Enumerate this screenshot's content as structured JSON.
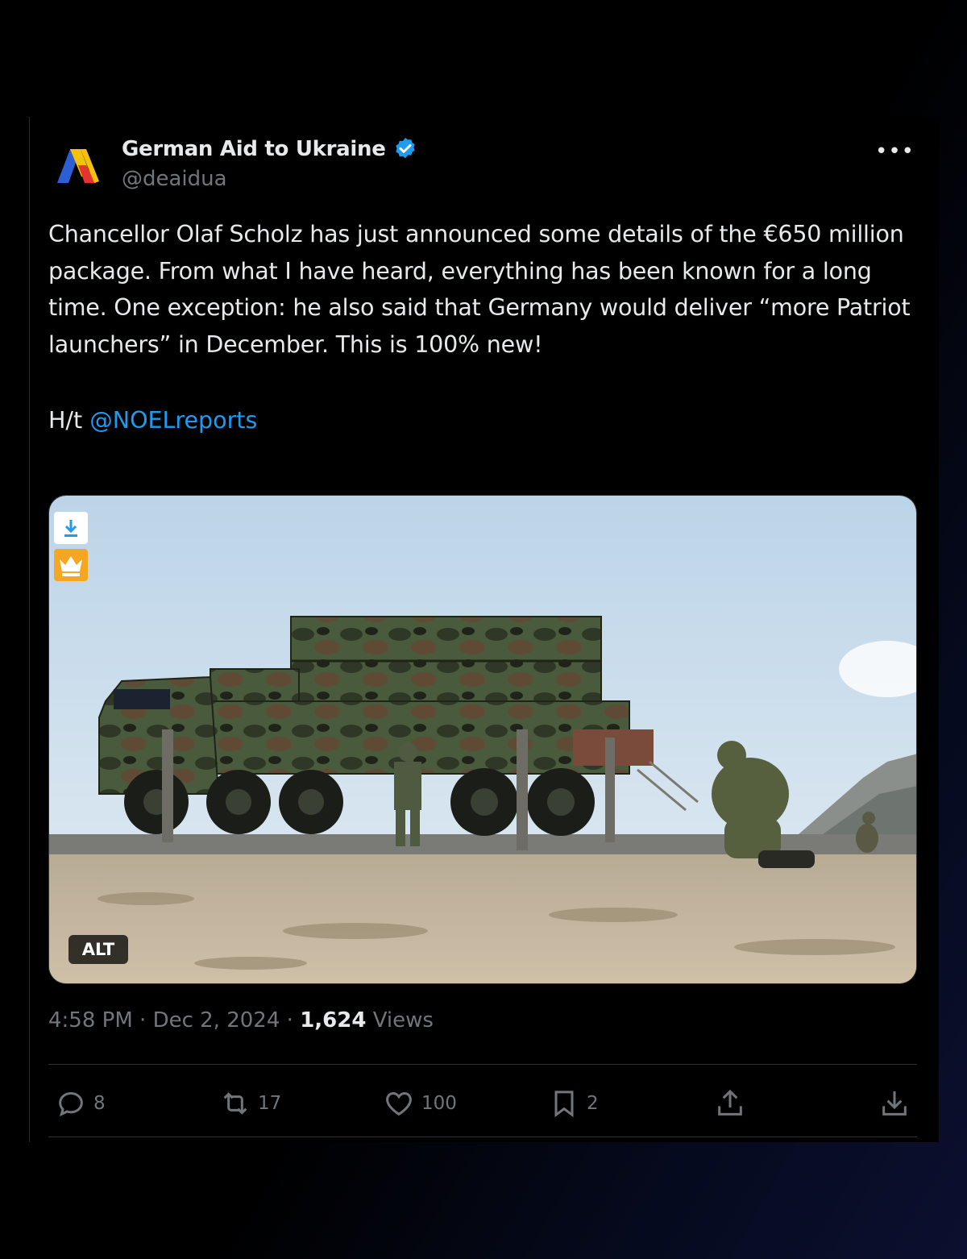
{
  "author": {
    "display_name": "German Aid to Ukraine",
    "handle": "@deaidua",
    "verified": true
  },
  "more_icon": "more-dots-icon",
  "tweet": {
    "text": "Chancellor Olaf Scholz has just announced some details of the €650 million package. From what I have heard, everything has been known for a long time. One exception: he also said that Germany would deliver “more Patriot launchers” in December. This is 100% new!",
    "ht_prefix": "H/t ",
    "mention": "@NOELreports"
  },
  "media": {
    "alt_label": "ALT",
    "extension_buttons": [
      "download-icon",
      "crown-icon"
    ]
  },
  "meta": {
    "time": "4:58 PM",
    "sep1": " · ",
    "date": "Dec 2, 2024",
    "sep2": " · ",
    "views_count": "1,624",
    "views_label": " Views"
  },
  "actions": {
    "replies": "8",
    "reposts": "17",
    "likes": "100",
    "bookmarks": "2"
  },
  "colors": {
    "accent": "#1d9bf0",
    "muted": "#71767b",
    "text": "#e7e9ea",
    "background": "#000000"
  }
}
